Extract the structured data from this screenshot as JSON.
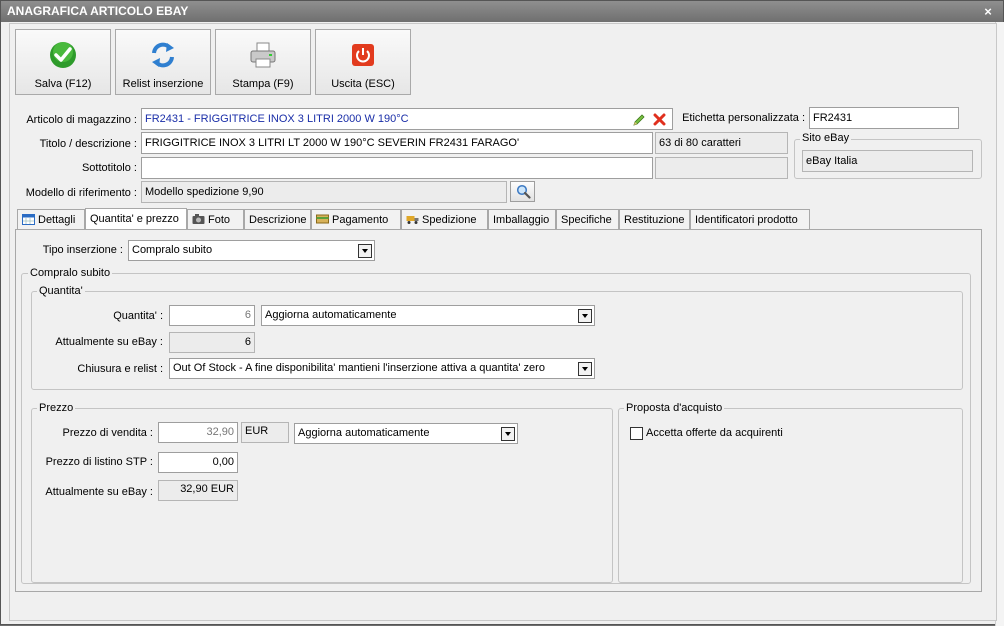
{
  "window": {
    "title": "ANAGRAFICA ARTICOLO EBAY",
    "close_label": "×"
  },
  "toolbar": {
    "save_label": "Salva (F12)",
    "relist_label": "Relist inserzione",
    "print_label": "Stampa (F9)",
    "exit_label": "Uscita (ESC)"
  },
  "header": {
    "article_label": "Articolo di magazzino :",
    "article_value": "FR2431 - FRIGGITRICE INOX 3 LITRI 2000 W 190°C",
    "custom_label_label": "Etichetta personalizzata :",
    "custom_label_value": "FR2431",
    "title_label": "Titolo / descrizione :",
    "title_value": "FRIGGITRICE INOX 3 LITRI LT 2000 W 190°C SEVERIN FR2431 FARAGO'",
    "char_count": "63 di 80 caratteri",
    "subtitle_label": "Sottotitolo :",
    "subtitle_value": "",
    "subtitle_count": "",
    "model_label": "Modello di riferimento :",
    "model_value": "Modello spedizione 9,90",
    "site_group_title": "Sito eBay",
    "site_value": "eBay Italia"
  },
  "tabs": [
    {
      "label": "Dettagli"
    },
    {
      "label": "Quantita' e prezzo"
    },
    {
      "label": "Foto"
    },
    {
      "label": "Descrizione"
    },
    {
      "label": "Pagamento"
    },
    {
      "label": "Spedizione"
    },
    {
      "label": "Imballaggio"
    },
    {
      "label": "Specifiche"
    },
    {
      "label": "Restituzione"
    },
    {
      "label": "Identificatori prodotto"
    }
  ],
  "panel": {
    "insertion_type_label": "Tipo inserzione :",
    "insertion_type_value": "Compralo subito",
    "compralo_group_title": "Compralo subito",
    "qty_group_title": "Quantita'",
    "qty_label": "Quantita' :",
    "qty_value": "6",
    "qty_mode_value": "Aggiorna automaticamente",
    "qty_current_label": "Attualmente su eBay :",
    "qty_current_value": "6",
    "close_relist_label": "Chiusura e relist :",
    "close_relist_value": "Out Of Stock - A fine disponibilita' mantieni l'inserzione attiva a quantita' zero",
    "price_group_title": "Prezzo",
    "sale_price_label": "Prezzo di vendita :",
    "sale_price_value": "32,90",
    "currency_value": "EUR",
    "price_mode_value": "Aggiorna automaticamente",
    "list_price_label": "Prezzo di listino STP :",
    "list_price_value": "0,00",
    "price_current_label": "Attualmente su eBay :",
    "price_current_value": "32,90 EUR",
    "offer_group_title": "Proposta d'acquisto",
    "accept_offers_label": "Accetta offerte da acquirenti",
    "accept_offers_checked": false
  },
  "colors": {
    "accent_blue": "#1a2ea8",
    "title_gray": "#7a7a7a"
  }
}
